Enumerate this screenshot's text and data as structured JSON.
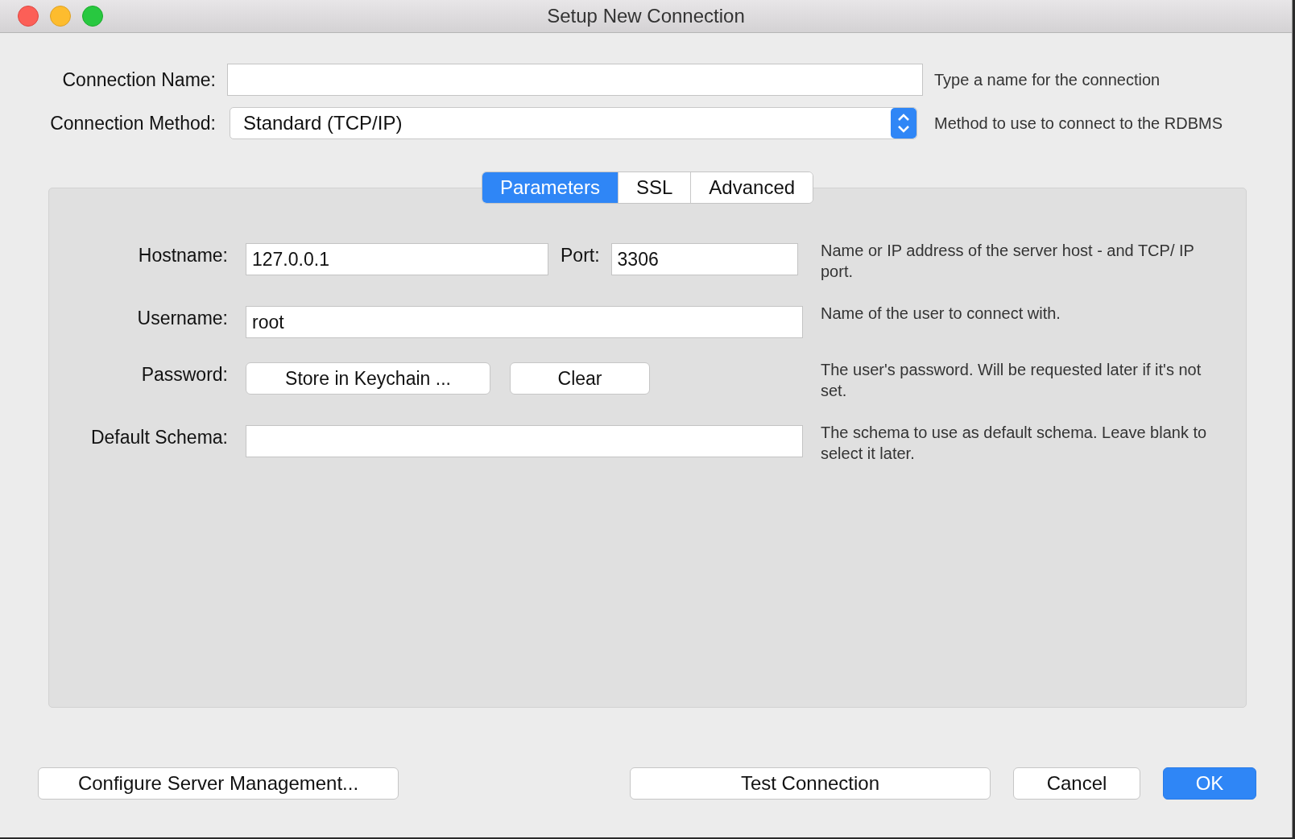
{
  "window": {
    "title": "Setup New Connection"
  },
  "connection_name": {
    "label": "Connection Name:",
    "hint": "Type a name for the connection"
  },
  "connection_method": {
    "label": "Connection Method:",
    "value": "Standard (TCP/IP)",
    "hint": "Method to use to connect to the RDBMS"
  },
  "tabs": [
    {
      "label": "Parameters",
      "selected": true
    },
    {
      "label": "SSL",
      "selected": false
    },
    {
      "label": "Advanced",
      "selected": false
    }
  ],
  "hostname": {
    "label": "Hostname:",
    "value": "127.0.0.1",
    "port_label": "Port:",
    "port_value": "3306",
    "hint": "Name or IP address of the server host - and TCP/ IP port."
  },
  "username": {
    "label": "Username:",
    "value": "root",
    "hint": "Name of the user to connect with."
  },
  "password": {
    "label": "Password:",
    "buttons": [
      "Store in Keychain ...",
      "Clear"
    ],
    "hint": "The user's password. Will be requested later if it's not set."
  },
  "default_schema": {
    "label": "Default Schema:",
    "hint": "The schema to use as default schema. Leave blank to select it later."
  },
  "footer_left": {
    "label": "Configure Server Management...",
    "primary": false
  },
  "footer_right": [
    {
      "label": "Test Connection",
      "primary": false
    },
    {
      "label": "Cancel",
      "primary": false
    },
    {
      "label": "OK",
      "primary": true
    }
  ]
}
